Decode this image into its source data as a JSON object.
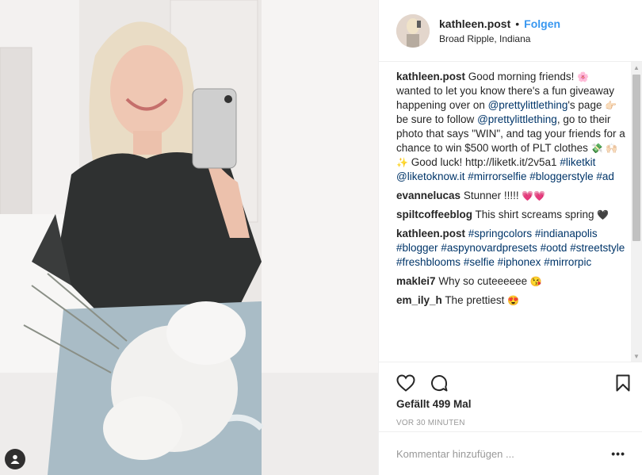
{
  "header": {
    "username": "kathleen.post",
    "separator": "•",
    "follow_label": "Folgen",
    "location": "Broad Ripple, Indiana"
  },
  "caption": {
    "username": "kathleen.post",
    "t1": "Good morning friends! ",
    "e1": "🌸",
    "t2": " wanted to let you know there's a fun giveaway happening over on ",
    "mention1": "@prettylittlething",
    "t3": "'s page ",
    "e2": "👉🏻",
    "t4": " be sure to follow ",
    "mention2": "@prettylittlething",
    "t5": ", go to their photo that says \"WIN\", and tag your friends for a chance to win $500 worth of PLT clothes ",
    "e3": "💸",
    "e4": "🙌🏻✨",
    "t6": " Good luck! http://liketk.it/2v5a1 ",
    "tag1": "#liketkit",
    "mention3": "@liketoknow.it",
    "tag2": "#mirrorselfie",
    "tag3": "#bloggerstyle",
    "tag4": "#ad"
  },
  "comments": [
    {
      "user": "evannelucas",
      "text": "Stunner !!!!! ",
      "emoji": "💗💗"
    },
    {
      "user": "spiltcoffeeblog",
      "text": "This shirt screams spring ",
      "emoji": "🖤"
    },
    {
      "user": "kathleen.post",
      "tags": [
        "#springcolors",
        "#indianapolis",
        "#blogger",
        "#aspynovardpresets",
        "#ootd",
        "#streetstyle",
        "#freshblooms",
        "#selfie",
        "#iphonex",
        "#mirrorpic"
      ]
    },
    {
      "user": "maklei7",
      "text": "Why so cuteeeeee ",
      "emoji": "😘"
    },
    {
      "user": "em_ily_h",
      "text": "The prettiest ",
      "emoji": "😍"
    }
  ],
  "likes": "Gefällt 499 Mal",
  "timestamp": "VOR 30 MINUTEN",
  "comment_placeholder": "Kommentar hinzufügen ...",
  "more_label": "•••",
  "icons": {
    "like": "heart-icon",
    "comment": "comment-bubble-icon",
    "save": "bookmark-icon",
    "tag": "user-tag-icon"
  },
  "colors": {
    "follow": "#3897f0",
    "link": "#003569",
    "muted": "#999999"
  }
}
